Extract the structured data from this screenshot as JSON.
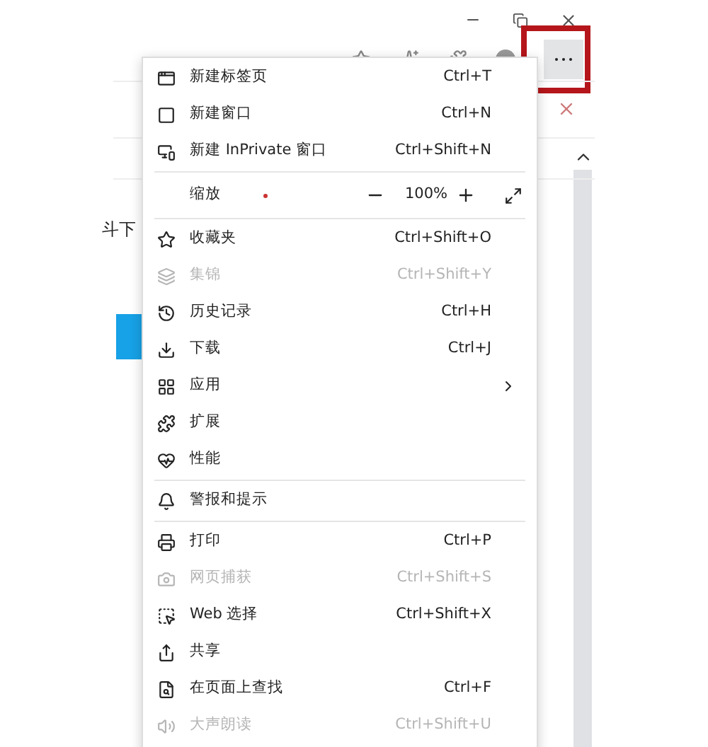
{
  "page": {
    "partial_text": "斗下"
  },
  "zoom": {
    "label": "缩放",
    "value": "100%"
  },
  "menu": {
    "items": [
      {
        "kind": "item",
        "label": "新建标签页",
        "shortcut": "Ctrl+T",
        "disabled": false
      },
      {
        "kind": "item",
        "label": "新建窗口",
        "shortcut": "Ctrl+N",
        "disabled": false
      },
      {
        "kind": "item",
        "label": "新建 InPrivate 窗口",
        "shortcut": "Ctrl+Shift+N",
        "disabled": false
      },
      {
        "kind": "divider"
      },
      {
        "kind": "zoom"
      },
      {
        "kind": "divider"
      },
      {
        "kind": "item",
        "label": "收藏夹",
        "shortcut": "Ctrl+Shift+O",
        "disabled": false
      },
      {
        "kind": "item",
        "label": "集锦",
        "shortcut": "Ctrl+Shift+Y",
        "disabled": true
      },
      {
        "kind": "item",
        "label": "历史记录",
        "shortcut": "Ctrl+H",
        "disabled": false
      },
      {
        "kind": "item",
        "label": "下载",
        "shortcut": "Ctrl+J",
        "disabled": false
      },
      {
        "kind": "item",
        "label": "应用",
        "submenu": true,
        "disabled": false
      },
      {
        "kind": "item",
        "label": "扩展",
        "disabled": false
      },
      {
        "kind": "item",
        "label": "性能",
        "disabled": false
      },
      {
        "kind": "divider"
      },
      {
        "kind": "item",
        "label": "警报和提示",
        "disabled": false
      },
      {
        "kind": "divider"
      },
      {
        "kind": "item",
        "label": "打印",
        "shortcut": "Ctrl+P",
        "disabled": false
      },
      {
        "kind": "item",
        "label": "网页捕获",
        "shortcut": "Ctrl+Shift+S",
        "disabled": true
      },
      {
        "kind": "item",
        "label": "Web 选择",
        "shortcut": "Ctrl+Shift+X",
        "disabled": false
      },
      {
        "kind": "item",
        "label": "共享",
        "disabled": false
      },
      {
        "kind": "item",
        "label": "在页面上查找",
        "shortcut": "Ctrl+F",
        "disabled": false
      },
      {
        "kind": "item",
        "label": "大声朗读",
        "shortcut": "Ctrl+Shift+U",
        "disabled": true
      }
    ]
  }
}
